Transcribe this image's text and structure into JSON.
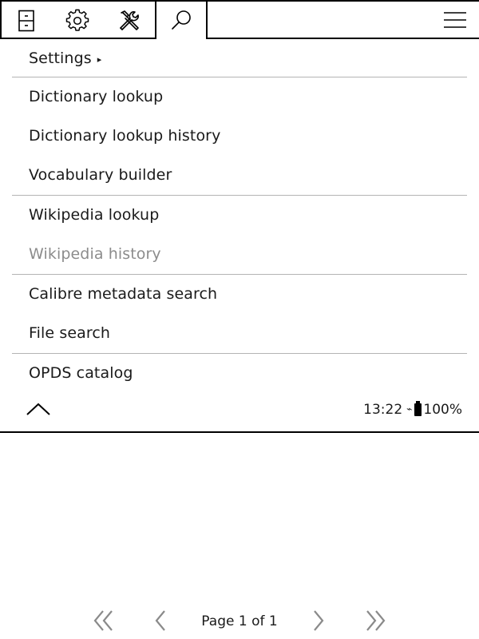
{
  "tabbar": {
    "tabs": [
      {
        "icon": "file-cabinet-icon"
      },
      {
        "icon": "gear-icon"
      },
      {
        "icon": "tools-icon"
      },
      {
        "icon": "search-icon",
        "active": true
      }
    ],
    "menu_icon": "hamburger-menu-icon"
  },
  "menu": {
    "items": [
      {
        "label": "Settings",
        "submenu": true
      },
      {
        "label": "Dictionary lookup"
      },
      {
        "label": "Dictionary lookup history"
      },
      {
        "label": "Vocabulary builder"
      },
      {
        "label": "Wikipedia lookup"
      },
      {
        "label": "Wikipedia history",
        "disabled": true
      },
      {
        "label": "Calibre metadata search"
      },
      {
        "label": "File search"
      },
      {
        "label": "OPDS catalog"
      }
    ],
    "submenu_arrow": "▸"
  },
  "status": {
    "time": "13:22",
    "connection": "⌁",
    "battery": "100%"
  },
  "pager": {
    "label": "Page 1 of 1"
  }
}
